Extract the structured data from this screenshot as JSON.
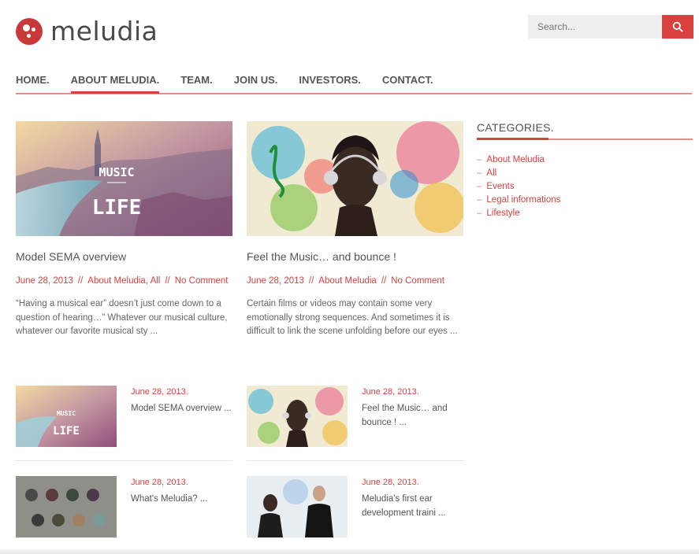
{
  "brand": {
    "name": "meludia",
    "accent": "#d9413f"
  },
  "search": {
    "placeholder": "Search..."
  },
  "nav": [
    "HOME.",
    "ABOUT MELUDIA.",
    "TEAM.",
    "JOIN US.",
    "INVESTORS.",
    "CONTACT."
  ],
  "featured": [
    {
      "title": "Model SEMA overview",
      "date": "June 28, 2013",
      "category": "About Meludia, All",
      "comments": "No Comment",
      "excerpt": "“Having a musical ear” doesn’t just come down to a question of hearing…” Whatever our musical culture, whatever our favorite musical sty ...",
      "image_text_top": "MUSIC",
      "image_text_bottom": "LIFE"
    },
    {
      "title": "Feel the Music… and bounce !",
      "date": "June 28, 2013",
      "category": "About Meludia",
      "comments": "No Comment",
      "excerpt": "Certain films or videos may contain some very emotionally strong sequences. And sometimes it is difficult to link the scene unfolding before our eyes ..."
    }
  ],
  "small_posts": [
    {
      "date": "June 28, 2013.",
      "title": "Model SEMA overview ..."
    },
    {
      "date": "June 28, 2013.",
      "title": "Feel the Music… and bounce ! ..."
    },
    {
      "date": "June 28, 2013.",
      "title": "What's Meludia? ..."
    },
    {
      "date": "June 28, 2013.",
      "title": "Meludia's first ear development traini ..."
    }
  ],
  "sidebar": {
    "title": "CATEGORIES.",
    "categories": [
      "About Meludia",
      "All",
      "Events",
      "Legal informations",
      "Lifestyle"
    ]
  }
}
